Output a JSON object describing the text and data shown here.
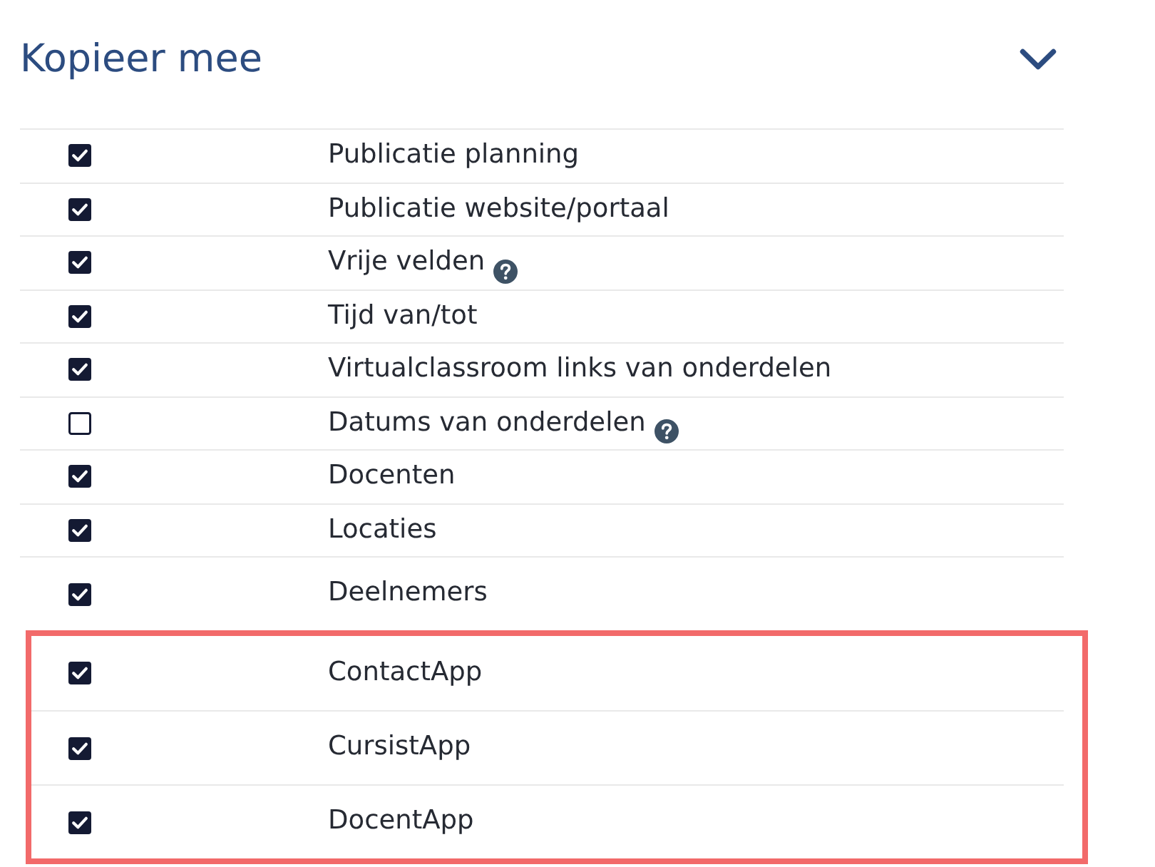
{
  "section": {
    "title": "Kopieer mee",
    "expanded": true
  },
  "options": [
    {
      "label": "Publicatie planning",
      "checked": true,
      "help": false,
      "highlighted": false
    },
    {
      "label": "Publicatie website/portaal",
      "checked": true,
      "help": false,
      "highlighted": false
    },
    {
      "label": "Vrije velden",
      "checked": true,
      "help": true,
      "highlighted": false
    },
    {
      "label": "Tijd van/tot",
      "checked": true,
      "help": false,
      "highlighted": false
    },
    {
      "label": "Virtualclassroom links van onderdelen",
      "checked": true,
      "help": false,
      "highlighted": false
    },
    {
      "label": "Datums van onderdelen",
      "checked": false,
      "help": true,
      "highlighted": false
    },
    {
      "label": "Docenten",
      "checked": true,
      "help": false,
      "highlighted": false
    },
    {
      "label": "Locaties",
      "checked": true,
      "help": false,
      "highlighted": false
    },
    {
      "label": "Deelnemers",
      "checked": true,
      "help": false,
      "highlighted": false
    },
    {
      "label": "ContactApp",
      "checked": true,
      "help": false,
      "highlighted": true
    },
    {
      "label": "CursistApp",
      "checked": true,
      "help": false,
      "highlighted": true
    },
    {
      "label": "DocentApp",
      "checked": true,
      "help": false,
      "highlighted": true
    }
  ]
}
